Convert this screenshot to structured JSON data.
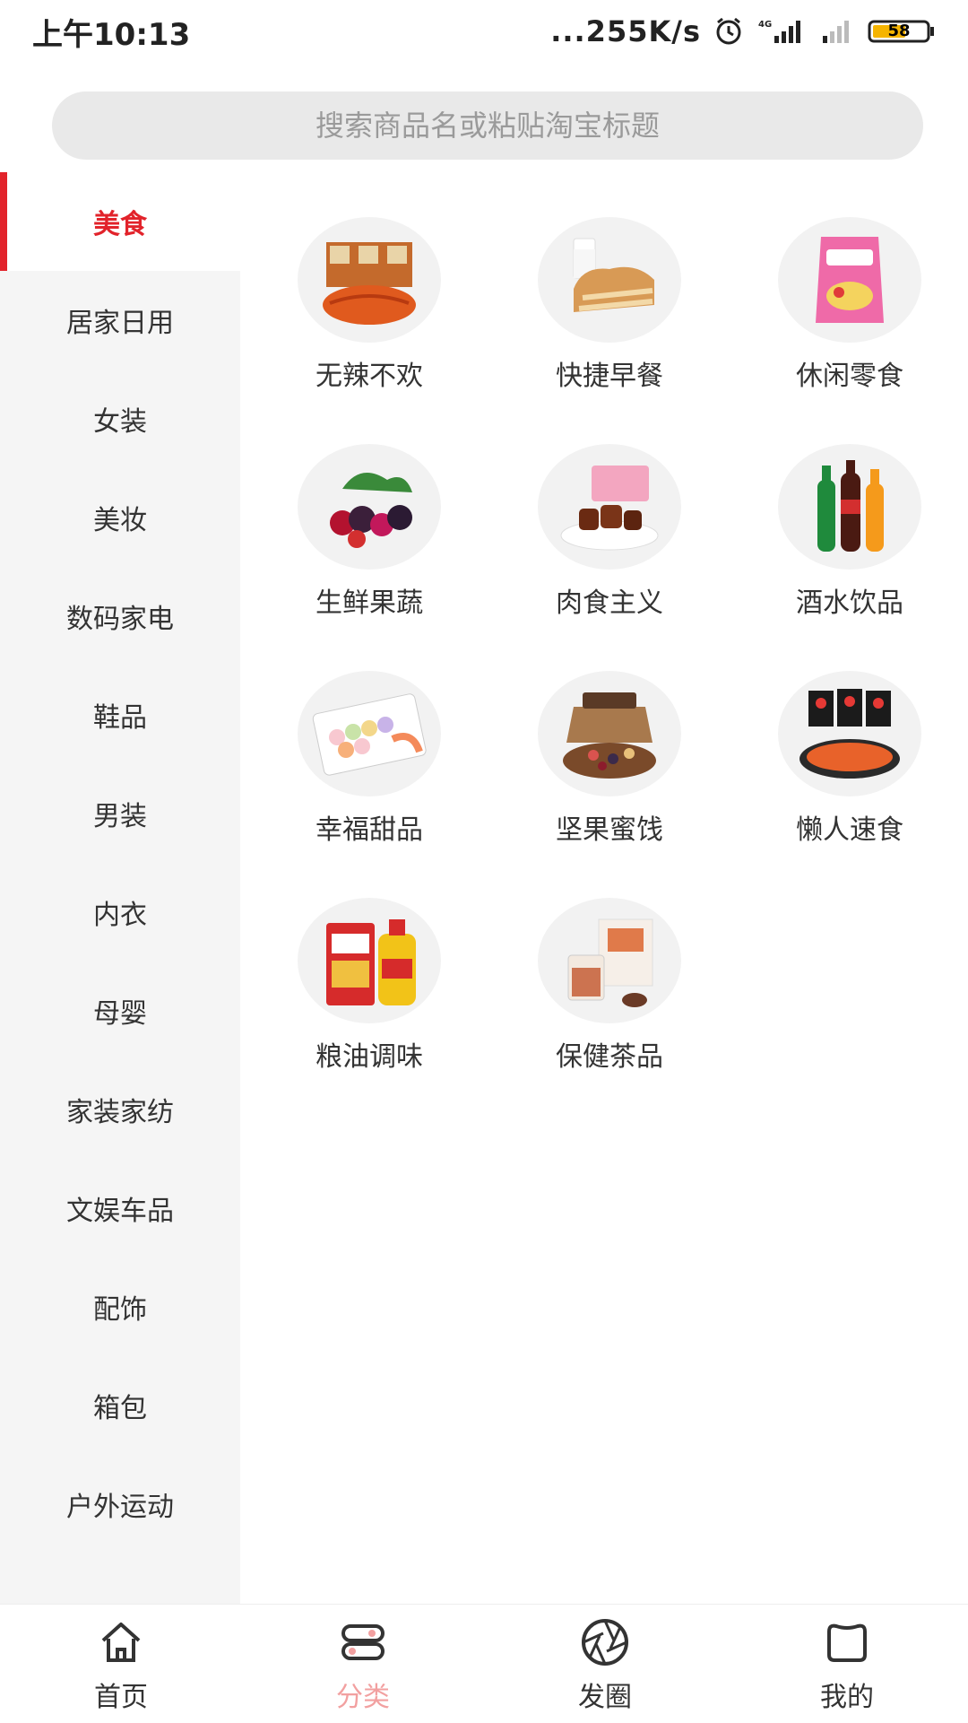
{
  "status_bar": {
    "time": "上午10:13",
    "net_speed": "...255K/s",
    "network": "4G",
    "battery": "58"
  },
  "search": {
    "placeholder": "搜索商品名或粘贴淘宝标题"
  },
  "sidebar": {
    "items": [
      {
        "label": "美食",
        "active": true
      },
      {
        "label": "居家日用"
      },
      {
        "label": "女装"
      },
      {
        "label": "美妆"
      },
      {
        "label": "数码家电"
      },
      {
        "label": "鞋品"
      },
      {
        "label": "男装"
      },
      {
        "label": "内衣"
      },
      {
        "label": "母婴"
      },
      {
        "label": "家装家纺"
      },
      {
        "label": "文娱车品"
      },
      {
        "label": "配饰"
      },
      {
        "label": "箱包"
      },
      {
        "label": "户外运动"
      }
    ]
  },
  "categories": [
    {
      "label": "无辣不欢",
      "image": "spicy-snack-image"
    },
    {
      "label": "快捷早餐",
      "image": "bread-milk-image"
    },
    {
      "label": "休闲零食",
      "image": "chips-image"
    },
    {
      "label": "生鲜果蔬",
      "image": "berries-image"
    },
    {
      "label": "肉食主义",
      "image": "meat-image"
    },
    {
      "label": "酒水饮品",
      "image": "drinks-image"
    },
    {
      "label": "幸福甜品",
      "image": "macarons-image"
    },
    {
      "label": "坚果蜜饯",
      "image": "nuts-image"
    },
    {
      "label": "懒人速食",
      "image": "noodles-image"
    },
    {
      "label": "粮油调味",
      "image": "rice-oil-image"
    },
    {
      "label": "保健茶品",
      "image": "tea-image"
    }
  ],
  "tabbar": {
    "items": [
      {
        "label": "首页",
        "icon": "home-icon"
      },
      {
        "label": "分类",
        "icon": "category-icon",
        "active": true
      },
      {
        "label": "发圈",
        "icon": "aperture-icon"
      },
      {
        "label": "我的",
        "icon": "profile-icon"
      }
    ]
  },
  "colors": {
    "accent": "#e2232b",
    "tab_active": "#f2a0a0",
    "sidebar_bg": "#f5f5f5",
    "search_bg": "#e9e9e9"
  }
}
